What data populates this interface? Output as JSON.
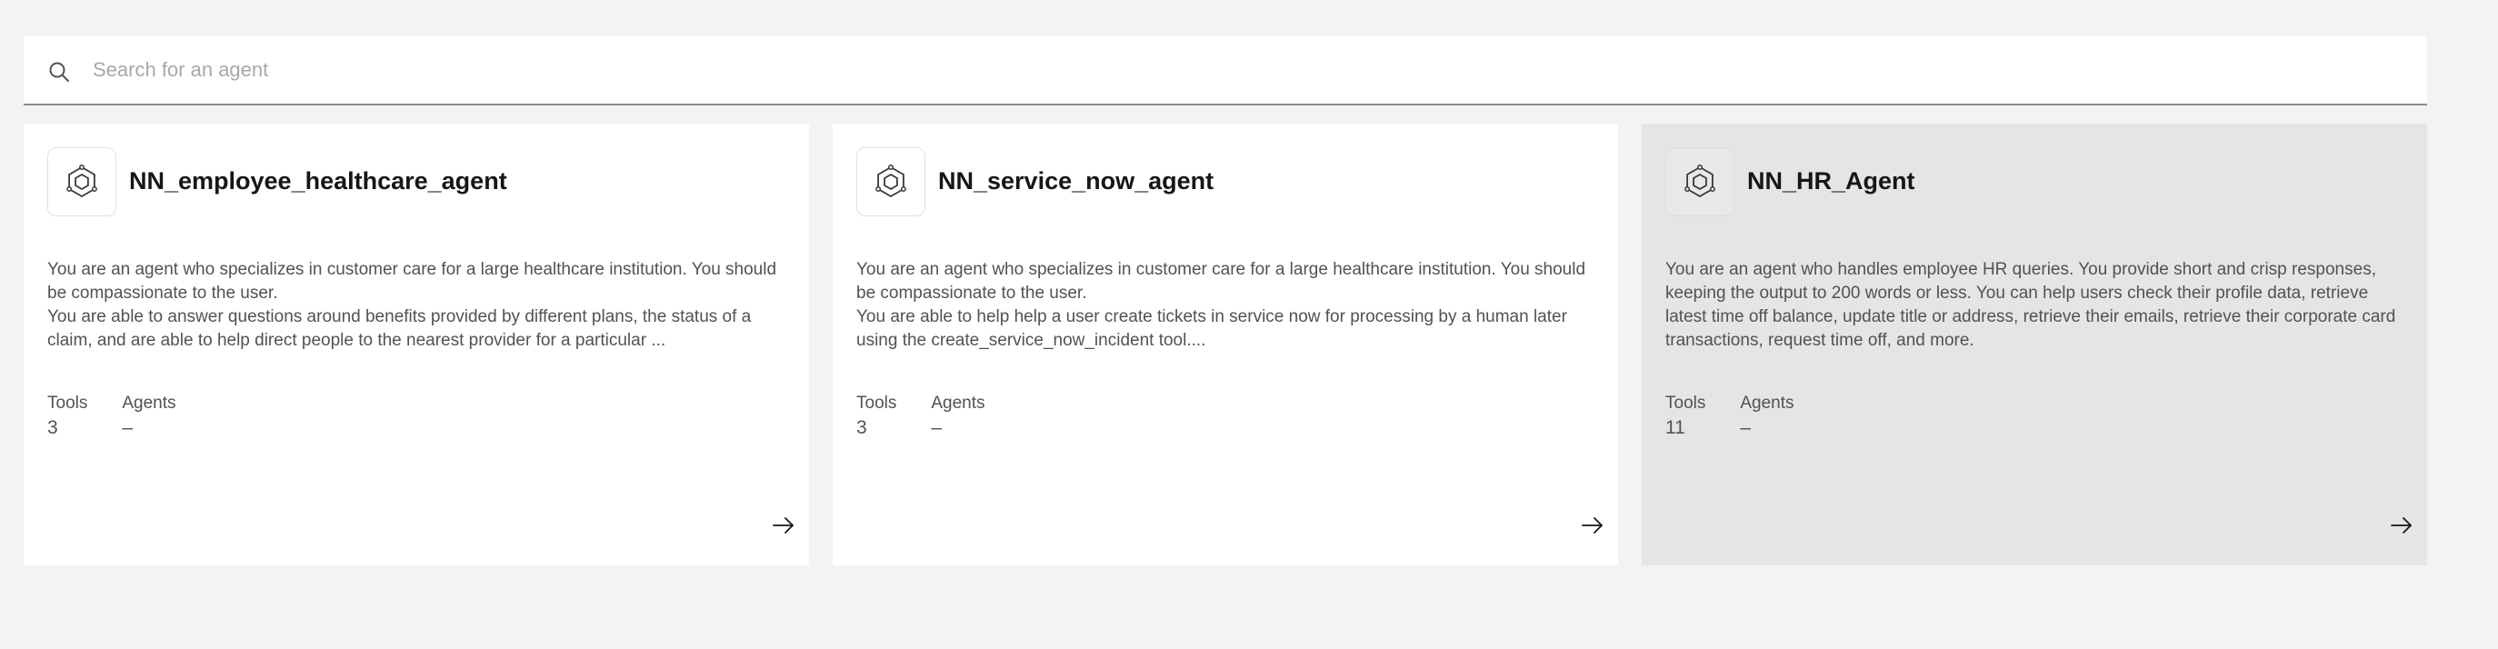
{
  "search": {
    "placeholder": "Search for an agent",
    "value": ""
  },
  "icons": {
    "search": "search-icon",
    "agent": "agent-hexagon-icon",
    "open": "arrow-right-icon"
  },
  "colors": {
    "page_background": "#f3f3f3",
    "card_background": "#ffffff",
    "card_hover_background": "#e5e5e5",
    "text_primary": "#161616",
    "text_secondary": "#525252"
  },
  "cards": [
    {
      "name": "NN_employee_healthcare_agent",
      "description_lines": [
        "You are an agent who specializes in customer care for a large healthcare institution. You should be compassionate to the user.",
        "You are able to answer questions around benefits provided by different plans, the status of a claim, and are able to help direct people to the nearest provider for a particular ..."
      ],
      "tools_label": "Tools",
      "tools_value": "3",
      "agents_label": "Agents",
      "agents_value": "–",
      "hovered": false
    },
    {
      "name": "NN_service_now_agent",
      "description_lines": [
        "You are an agent who specializes in customer care for a large healthcare institution. You should be compassionate to the user.",
        "You are able to help help a user create tickets in service now for processing by a human later using the create_service_now_incident tool...."
      ],
      "tools_label": "Tools",
      "tools_value": "3",
      "agents_label": "Agents",
      "agents_value": "–",
      "hovered": false
    },
    {
      "name": "NN_HR_Agent",
      "description_lines": [
        "You are an agent who handles employee HR queries.  You provide short and crisp responses, keeping the output to 200 words or less.  You can help users check their profile data, retrieve latest time off balance, update title or address, retrieve their emails, retrieve their corporate card transactions, request time off, and more."
      ],
      "tools_label": "Tools",
      "tools_value": "11",
      "agents_label": "Agents",
      "agents_value": "–",
      "hovered": true
    }
  ]
}
